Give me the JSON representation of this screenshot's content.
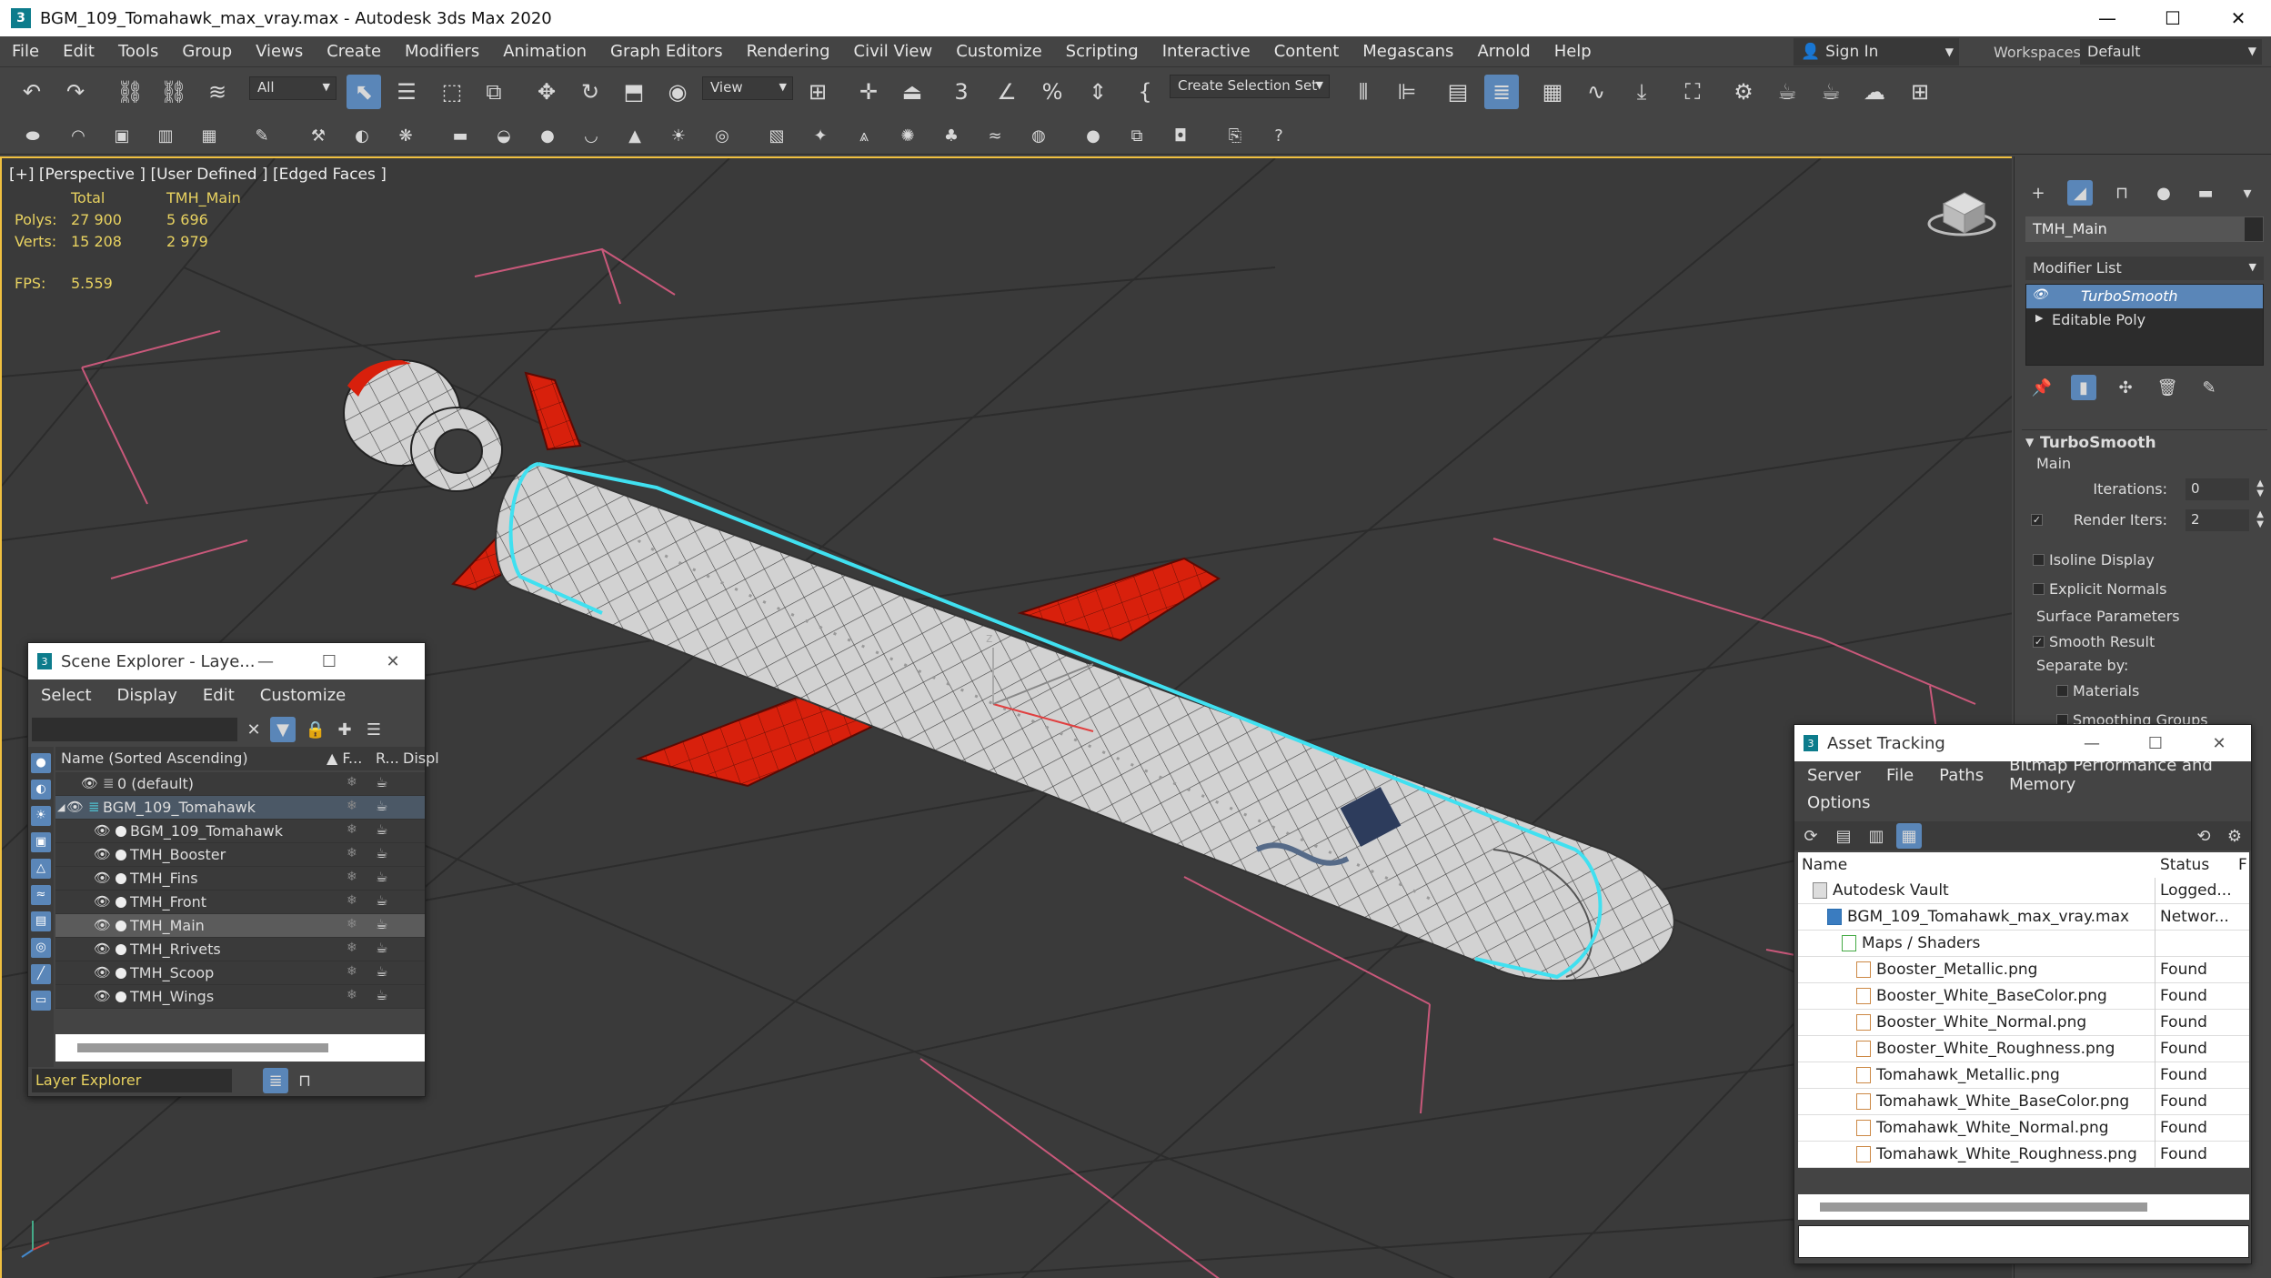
{
  "window": {
    "title": "BGM_109_Tomahawk_max_vray.max - Autodesk 3ds Max 2020",
    "app_icon": "3",
    "controls": [
      "—",
      "☐",
      "✕"
    ]
  },
  "menu": [
    "File",
    "Edit",
    "Tools",
    "Group",
    "Views",
    "Create",
    "Modifiers",
    "Animation",
    "Graph Editors",
    "Rendering",
    "Civil View",
    "Customize",
    "Scripting",
    "Interactive",
    "Content",
    "Megascans",
    "Arnold",
    "Help"
  ],
  "signin": {
    "label": "Sign In"
  },
  "workspaces": {
    "label": "Workspaces:",
    "value": "Default"
  },
  "toolbar": {
    "selection_filter": "All",
    "ref_coord": "View",
    "named_selection": "Create Selection Set"
  },
  "viewport": {
    "label": "[+] [Perspective ] [User Defined ] [Edged Faces ]",
    "stats": {
      "header": [
        "",
        "Total",
        "TMH_Main"
      ],
      "rows": [
        [
          "Polys:",
          "27 900",
          "5 696"
        ],
        [
          "Verts:",
          "15 208",
          "2 979"
        ]
      ],
      "fps_label": "FPS:",
      "fps_value": "5.559"
    },
    "axis_label": "z"
  },
  "command_panel": {
    "object_name": "TMH_Main",
    "modifier_list": "Modifier List",
    "stack": [
      "TurboSmooth",
      "Editable Poly"
    ],
    "rollout_title": "TurboSmooth",
    "main_label": "Main",
    "iterations_label": "Iterations:",
    "iterations_value": "0",
    "render_iters_label": "Render Iters:",
    "render_iters_value": "2",
    "isoline": "Isoline Display",
    "explicit_normals": "Explicit Normals",
    "surface_params": "Surface Parameters",
    "smooth_result": "Smooth Result",
    "separate_by": "Separate by:",
    "materials": "Materials",
    "smoothing_groups": "Smoothing Groups"
  },
  "scene_explorer": {
    "title": "Scene Explorer - Laye...",
    "menu": [
      "Select",
      "Display",
      "Edit",
      "Customize"
    ],
    "columns": [
      "Name (Sorted Ascending)",
      "▲ F...",
      "R...",
      "Displ"
    ],
    "rows": [
      {
        "name": "0 (default)",
        "level": 1
      },
      {
        "name": "BGM_109_Tomahawk",
        "level": 0
      },
      {
        "name": "BGM_109_Tomahawk",
        "level": 2
      },
      {
        "name": "TMH_Booster",
        "level": 2
      },
      {
        "name": "TMH_Fins",
        "level": 2
      },
      {
        "name": "TMH_Front",
        "level": 2
      },
      {
        "name": "TMH_Main",
        "level": 2
      },
      {
        "name": "TMH_Rrivets",
        "level": 2
      },
      {
        "name": "TMH_Scoop",
        "level": 2
      },
      {
        "name": "TMH_Wings",
        "level": 2
      }
    ],
    "footer_label": "Layer Explorer"
  },
  "asset_tracking": {
    "title": "Asset Tracking",
    "menu": [
      "Server",
      "File",
      "Paths",
      "Bitmap Performance and Memory"
    ],
    "menu2": [
      "Options"
    ],
    "columns": [
      "Name",
      "Status",
      "F"
    ],
    "rows": [
      {
        "name": "Autodesk Vault",
        "status": "Logged...",
        "indent": 0
      },
      {
        "name": "BGM_109_Tomahawk_max_vray.max",
        "status": "Networ...",
        "indent": 1
      },
      {
        "name": "Maps / Shaders",
        "status": "",
        "indent": 2
      },
      {
        "name": "Booster_Metallic.png",
        "status": "Found",
        "indent": 3
      },
      {
        "name": "Booster_White_BaseColor.png",
        "status": "Found",
        "indent": 3
      },
      {
        "name": "Booster_White_Normal.png",
        "status": "Found",
        "indent": 3
      },
      {
        "name": "Booster_White_Roughness.png",
        "status": "Found",
        "indent": 3
      },
      {
        "name": "Tomahawk_Metallic.png",
        "status": "Found",
        "indent": 3
      },
      {
        "name": "Tomahawk_White_BaseColor.png",
        "status": "Found",
        "indent": 3
      },
      {
        "name": "Tomahawk_White_Normal.png",
        "status": "Found",
        "indent": 3
      },
      {
        "name": "Tomahawk_White_Roughness.png",
        "status": "Found",
        "indent": 3
      }
    ]
  },
  "colors": {
    "accent": "#5a86b8",
    "stats_yellow": "#e8d260",
    "viewport_border": "#f0c040",
    "selection_cyan": "#40e0f0",
    "missile_red": "#d8200c"
  }
}
